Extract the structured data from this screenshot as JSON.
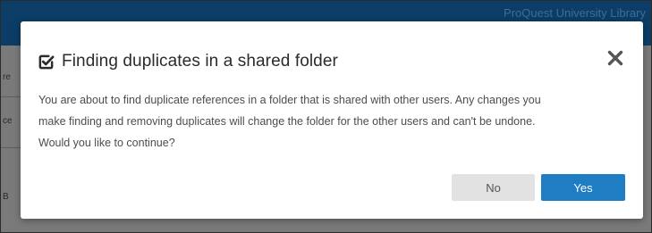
{
  "background": {
    "brand_text": "ProQuest University Library",
    "fragments": [
      "re",
      "ce",
      "B"
    ]
  },
  "dialog": {
    "title": "Finding duplicates in a shared folder",
    "title_icon": "checkbox-check-icon",
    "close_icon": "close-x-icon",
    "message_lines": [
      "You are about to find duplicate references in a folder that is shared with other users. Any changes you",
      "make finding and removing duplicates will change the folder for the other users and can't be undone.",
      "Would you like to continue?"
    ],
    "buttons": {
      "no_label": "No",
      "yes_label": "Yes"
    }
  },
  "colors": {
    "header": "#0b3d66",
    "primary_button": "#1f7dc4",
    "secondary_button": "#e2e2e2",
    "overlay": "#7a7a7a"
  }
}
